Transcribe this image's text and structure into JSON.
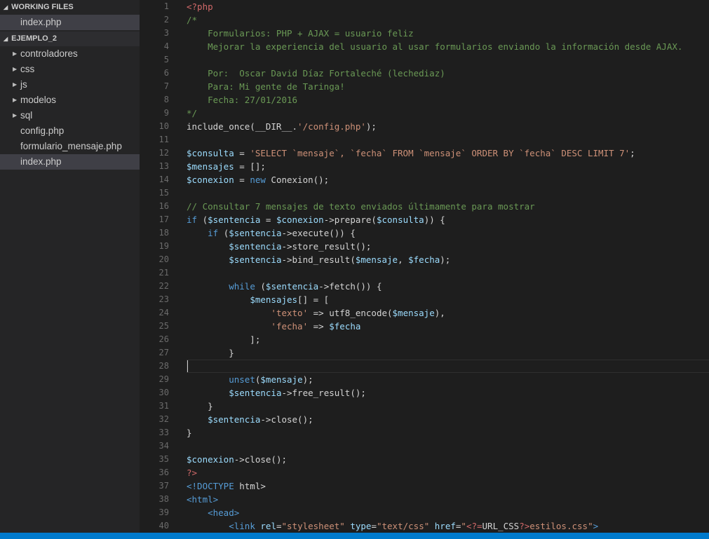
{
  "sidebar": {
    "working_files": {
      "header": "WORKING FILES",
      "files": [
        {
          "label": "index.php"
        }
      ]
    },
    "project": {
      "header": "EJEMPLO_2",
      "items": [
        {
          "label": "controladores",
          "type": "folder"
        },
        {
          "label": "css",
          "type": "folder"
        },
        {
          "label": "js",
          "type": "folder"
        },
        {
          "label": "modelos",
          "type": "folder"
        },
        {
          "label": "sql",
          "type": "folder"
        },
        {
          "label": "config.php",
          "type": "file"
        },
        {
          "label": "formulario_mensaje.php",
          "type": "file"
        },
        {
          "label": "index.php",
          "type": "file",
          "selected": true
        }
      ]
    }
  },
  "editor": {
    "file": "index.php",
    "cursor_line": 28,
    "lines": [
      [
        [
          "t-tag",
          "<?php"
        ]
      ],
      [
        [
          "t-comment",
          "/*"
        ]
      ],
      [
        [
          "t-comment",
          "    Formularios: PHP + AJAX = usuario feliz"
        ]
      ],
      [
        [
          "t-comment",
          "    Mejorar la experiencia del usuario al usar formularios enviando la información desde AJAX."
        ]
      ],
      [],
      [
        [
          "t-comment",
          "    Por:  Oscar David Díaz Fortaleché (lechediaz)"
        ]
      ],
      [
        [
          "t-comment",
          "    Para: Mi gente de Taringa!"
        ]
      ],
      [
        [
          "t-comment",
          "    Fecha: 27/01/2016"
        ]
      ],
      [
        [
          "t-comment",
          "*/"
        ]
      ],
      [
        [
          "",
          "include_once(__DIR__."
        ],
        [
          "t-str",
          "'/config.php'"
        ],
        [
          "",
          ");"
        ]
      ],
      [],
      [
        [
          "t-var",
          "$consulta"
        ],
        [
          "",
          " = "
        ],
        [
          "t-str",
          "'SELECT `mensaje`, `fecha` FROM `mensaje` ORDER BY `fecha` DESC LIMIT 7'"
        ],
        [
          "",
          ";"
        ]
      ],
      [
        [
          "t-var",
          "$mensajes"
        ],
        [
          "",
          " = [];"
        ]
      ],
      [
        [
          "t-var",
          "$conexion"
        ],
        [
          "",
          " = "
        ],
        [
          "t-kw",
          "new"
        ],
        [
          "",
          " Conexion();"
        ]
      ],
      [],
      [
        [
          "t-comment",
          "// Consultar 7 mensajes de texto enviados últimamente para mostrar"
        ]
      ],
      [
        [
          "t-kw",
          "if"
        ],
        [
          "",
          " ("
        ],
        [
          "t-var",
          "$sentencia"
        ],
        [
          "",
          " = "
        ],
        [
          "t-var",
          "$conexion"
        ],
        [
          "",
          "->prepare("
        ],
        [
          "t-var",
          "$consulta"
        ],
        [
          "",
          ")) {"
        ]
      ],
      [
        [
          "",
          "    "
        ],
        [
          "t-kw",
          "if"
        ],
        [
          "",
          " ("
        ],
        [
          "t-var",
          "$sentencia"
        ],
        [
          "",
          "->execute()) {"
        ]
      ],
      [
        [
          "",
          "        "
        ],
        [
          "t-var",
          "$sentencia"
        ],
        [
          "",
          "->store_result();"
        ]
      ],
      [
        [
          "",
          "        "
        ],
        [
          "t-var",
          "$sentencia"
        ],
        [
          "",
          "->bind_result("
        ],
        [
          "t-var",
          "$mensaje"
        ],
        [
          "",
          ", "
        ],
        [
          "t-var",
          "$fecha"
        ],
        [
          "",
          ");"
        ]
      ],
      [],
      [
        [
          "",
          "        "
        ],
        [
          "t-kw",
          "while"
        ],
        [
          "",
          " ("
        ],
        [
          "t-var",
          "$sentencia"
        ],
        [
          "",
          "->fetch()) {"
        ]
      ],
      [
        [
          "",
          "            "
        ],
        [
          "t-var",
          "$mensajes"
        ],
        [
          "",
          "[] = ["
        ]
      ],
      [
        [
          "",
          "                "
        ],
        [
          "t-str",
          "'texto'"
        ],
        [
          "",
          " => utf8_encode("
        ],
        [
          "t-var",
          "$mensaje"
        ],
        [
          "",
          "),"
        ]
      ],
      [
        [
          "",
          "                "
        ],
        [
          "t-str",
          "'fecha'"
        ],
        [
          "",
          " => "
        ],
        [
          "t-var",
          "$fecha"
        ]
      ],
      [
        [
          "",
          "            ];"
        ]
      ],
      [
        [
          "",
          "        }"
        ]
      ],
      [],
      [
        [
          "",
          "        "
        ],
        [
          "t-kw",
          "unset"
        ],
        [
          "",
          "("
        ],
        [
          "t-var",
          "$mensaje"
        ],
        [
          "",
          ");"
        ]
      ],
      [
        [
          "",
          "        "
        ],
        [
          "t-var",
          "$sentencia"
        ],
        [
          "",
          "->free_result();"
        ]
      ],
      [
        [
          "",
          "    }"
        ]
      ],
      [
        [
          "",
          "    "
        ],
        [
          "t-var",
          "$sentencia"
        ],
        [
          "",
          "->close();"
        ]
      ],
      [
        [
          "",
          "}"
        ]
      ],
      [],
      [
        [
          "t-var",
          "$conexion"
        ],
        [
          "",
          "->close();"
        ]
      ],
      [
        [
          "t-tag",
          "?>"
        ]
      ],
      [
        [
          "t-kw",
          "<!DOCTYPE"
        ],
        [
          "",
          " html>"
        ]
      ],
      [
        [
          "t-kw",
          "<html>"
        ]
      ],
      [
        [
          "",
          "    "
        ],
        [
          "t-kw",
          "<head>"
        ]
      ],
      [
        [
          "",
          "        "
        ],
        [
          "t-kw",
          "<link"
        ],
        [
          "",
          " "
        ],
        [
          "t-attr",
          "rel"
        ],
        [
          "",
          "="
        ],
        [
          "t-str",
          "\"stylesheet\""
        ],
        [
          "",
          " "
        ],
        [
          "t-attr",
          "type"
        ],
        [
          "",
          "="
        ],
        [
          "t-str",
          "\"text/css\""
        ],
        [
          "",
          " "
        ],
        [
          "t-attr",
          "href"
        ],
        [
          "",
          "="
        ],
        [
          "t-str",
          "\""
        ],
        [
          "t-tag",
          "<?="
        ],
        [
          "",
          "URL_CSS"
        ],
        [
          "t-tag",
          "?>"
        ],
        [
          "t-str",
          "estilos.css\""
        ],
        [
          "t-kw",
          ">"
        ]
      ]
    ]
  }
}
